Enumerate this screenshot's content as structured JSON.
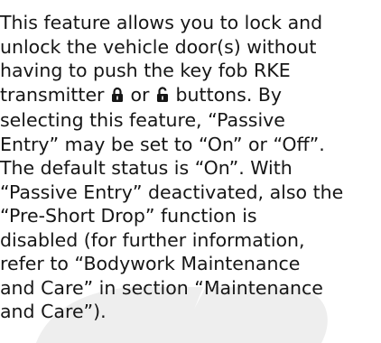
{
  "paragraph": {
    "lines": [
      "This feature allows you to lock and",
      "unlock the vehicle door(s) without",
      "having to push the key fob RKE",
      "selecting this feature, “Passive",
      "Entry” may be set to “On” or “Off”.",
      "The default status is “On”. With",
      "“Passive Entry” deactivated, also the",
      "“Pre-Short Drop” function is",
      "disabled (for further information,",
      "refer to “Bodywork Maintenance",
      "and Care” in section “Maintenance",
      "and Care”)."
    ],
    "line4": {
      "before_icons": "transmitter ",
      "between_icons": " or ",
      "after_icons": " buttons. By"
    }
  },
  "icons": {
    "lock": "lock-closed-icon",
    "unlock": "lock-open-icon"
  },
  "colors": {
    "text": "#161616",
    "watermark": "#eeeeee"
  }
}
